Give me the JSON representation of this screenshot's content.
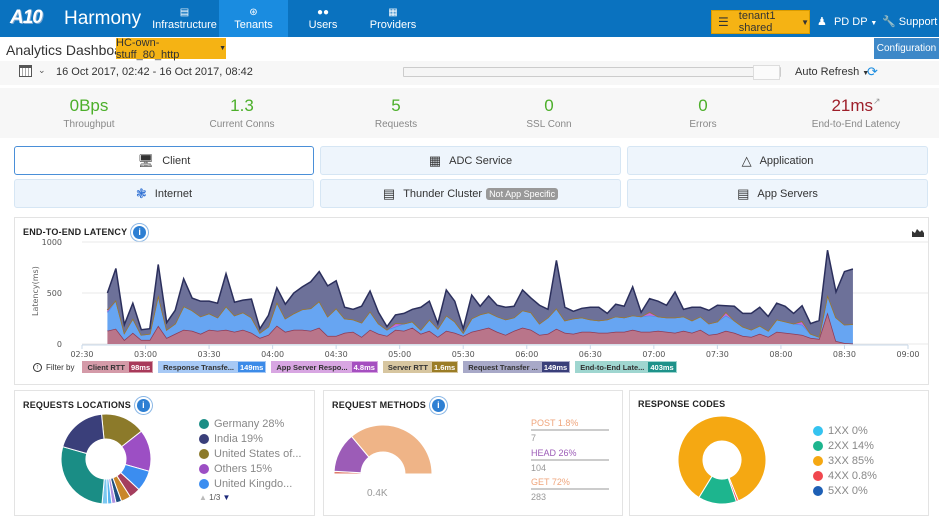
{
  "header": {
    "logo": "A10",
    "app_name": "Harmony",
    "nav": [
      {
        "label": "Infrastructure",
        "icon": "server-icon",
        "active": false
      },
      {
        "label": "Tenants",
        "icon": "tenants-icon",
        "active": true
      },
      {
        "label": "Users",
        "icon": "users-icon",
        "active": false
      },
      {
        "label": "Providers",
        "icon": "providers-icon",
        "active": false
      }
    ],
    "tenant_selector": "tenant1 shared",
    "user_menu": "PD DP",
    "support_menu": "Support"
  },
  "page": {
    "title": "Analytics Dashboard",
    "service_selector": "HC-own-stuff_80_http",
    "configuration_button": "Configuration"
  },
  "timebar": {
    "range": "16 Oct 2017, 02:42 - 16 Oct 2017, 08:42",
    "auto_refresh": "Auto Refresh"
  },
  "kpis": [
    {
      "value": "0Bps",
      "label": "Throughput",
      "status": "good"
    },
    {
      "value": "1.3",
      "label": "Current Conns",
      "status": "good"
    },
    {
      "value": "5",
      "label": "Requests",
      "status": "good"
    },
    {
      "value": "0",
      "label": "SSL Conn",
      "status": "good"
    },
    {
      "value": "0",
      "label": "Errors",
      "status": "good"
    },
    {
      "value": "21ms",
      "label": "End-to-End Latency",
      "status": "bad"
    }
  ],
  "tiles": [
    {
      "label": "Client",
      "icon": "client-monitor-icon",
      "selected": true
    },
    {
      "label": "ADC Service",
      "icon": "adc-service-icon",
      "selected": false
    },
    {
      "label": "Application",
      "icon": "application-icon",
      "selected": false
    },
    {
      "label": "Internet",
      "icon": "internet-icon",
      "selected": false
    },
    {
      "label": "Thunder Cluster",
      "icon": "cluster-icon",
      "badge": "Not App Specific",
      "selected": false
    },
    {
      "label": "App Servers",
      "icon": "app-servers-icon",
      "selected": false
    }
  ],
  "latency_panel": {
    "title": "END-TO-END LATENCY",
    "filter_label": "Filter by",
    "filters": [
      {
        "label": "Client RTT",
        "value": "98ms",
        "bg": "#d49aa8",
        "vbg": "#a8395a"
      },
      {
        "label": "Response Transfe...",
        "value": "149ms",
        "bg": "#a7c9f5",
        "vbg": "#3c8be8"
      },
      {
        "label": "App Server Respo...",
        "value": "4.8ms",
        "bg": "#d8a6e2",
        "vbg": "#a54fc0"
      },
      {
        "label": "Server RTT",
        "value": "1.6ms",
        "bg": "#d7c6a0",
        "vbg": "#9b7d26"
      },
      {
        "label": "Request Transfer ...",
        "value": "149ms",
        "bg": "#a8a9c8",
        "vbg": "#3a3f7a"
      },
      {
        "label": "End-to-End Late...",
        "value": "403ms",
        "bg": "#9fd6d0",
        "vbg": "#1e928a"
      }
    ]
  },
  "chart_data": [
    {
      "type": "area",
      "stacked": true,
      "title": "END-TO-END LATENCY",
      "xlabel": "",
      "ylabel": "Latency(ms)",
      "ylim": [
        0,
        1000
      ],
      "yticks": [
        "0",
        "500",
        "1000"
      ],
      "xlim": [
        "02:30",
        "09:00"
      ],
      "xticks": [
        "02:30",
        "03:00",
        "03:30",
        "04:00",
        "04:30",
        "05:00",
        "05:30",
        "06:00",
        "06:30",
        "07:00",
        "07:30",
        "08:00",
        "08:30",
        "09:00"
      ],
      "x_start_minutes": 162,
      "x_step_minutes": 4,
      "grid": true,
      "series": [
        {
          "name": "Client RTT",
          "color": "#b9758a",
          "line": "#8e3a55",
          "values": [
            130,
            150,
            40,
            110,
            40,
            40,
            180,
            60,
            100,
            140,
            130,
            100,
            140,
            130,
            140,
            120,
            140,
            110,
            60,
            90,
            180,
            120,
            140,
            140,
            130,
            160,
            80,
            80,
            110,
            120,
            70,
            140,
            100,
            80,
            140,
            130,
            160,
            100,
            130,
            70,
            130,
            110,
            80,
            120,
            140,
            160,
            120,
            90,
            130,
            160,
            140,
            90,
            100,
            150,
            110,
            100,
            120,
            120,
            110,
            110,
            120,
            120,
            140,
            120,
            120,
            130,
            120,
            110,
            130,
            110,
            140,
            90,
            100,
            130,
            110,
            80,
            70,
            100,
            70,
            120,
            110,
            100,
            90,
            60,
            50,
            310,
            30,
            10,
            5
          ]
        },
        {
          "name": "Response Transfer",
          "color": "#67a5f2",
          "line": "#4c8fe8",
          "values": [
            180,
            280,
            70,
            140,
            50,
            60,
            300,
            80,
            100,
            230,
            200,
            170,
            160,
            130,
            230,
            160,
            170,
            150,
            50,
            80,
            230,
            130,
            160,
            200,
            220,
            260,
            190,
            270,
            140,
            120,
            140,
            180,
            100,
            60,
            30,
            70,
            60,
            40,
            110,
            80,
            150,
            110,
            30,
            130,
            150,
            150,
            150,
            150,
            130,
            170,
            170,
            110,
            160,
            200,
            120,
            150,
            140,
            120,
            120,
            130,
            150,
            140,
            140,
            150,
            160,
            140,
            140,
            150,
            140,
            120,
            130,
            110,
            120,
            150,
            120,
            90,
            70,
            80,
            60,
            120,
            110,
            100,
            100,
            40,
            20,
            170,
            230,
            180,
            190
          ]
        },
        {
          "name": "App Server Response",
          "color": "#c76ed9",
          "line": "#a54fc0",
          "values": [
            20,
            0,
            0,
            0,
            0,
            0,
            0,
            0,
            0,
            0,
            0,
            0,
            0,
            0,
            0,
            0,
            0,
            0,
            0,
            0,
            0,
            0,
            0,
            0,
            0,
            0,
            0,
            0,
            0,
            0,
            0,
            0,
            0,
            0,
            30,
            0,
            0,
            0,
            0,
            0,
            0,
            0,
            0,
            0,
            0,
            0,
            0,
            0,
            0,
            0,
            0,
            0,
            0,
            0,
            0,
            0,
            0,
            0,
            0,
            0,
            0,
            0,
            0,
            0,
            30,
            0,
            0,
            0,
            0,
            0,
            0,
            0,
            0,
            30,
            0,
            0,
            0,
            0,
            0,
            0,
            0,
            0,
            30,
            0,
            0,
            0,
            0,
            0,
            0
          ]
        },
        {
          "name": "Server RTT",
          "color": "#b99a45",
          "line": "#9b7d26",
          "values": [
            5,
            0,
            0,
            0,
            0,
            0,
            0,
            0,
            0,
            0,
            0,
            0,
            0,
            0,
            0,
            0,
            0,
            0,
            0,
            0,
            0,
            0,
            0,
            0,
            0,
            0,
            0,
            0,
            0,
            0,
            0,
            0,
            0,
            0,
            5,
            0,
            0,
            0,
            0,
            0,
            0,
            0,
            0,
            0,
            0,
            0,
            0,
            0,
            0,
            0,
            0,
            0,
            0,
            0,
            0,
            0,
            0,
            0,
            0,
            0,
            0,
            0,
            0,
            0,
            5,
            0,
            0,
            0,
            0,
            0,
            0,
            0,
            0,
            5,
            0,
            0,
            0,
            0,
            0,
            0,
            0,
            0,
            5,
            0,
            0,
            0,
            0,
            0,
            0
          ]
        },
        {
          "name": "Request Transfer",
          "color": "#6d7199",
          "line": "#2b2f5c",
          "values": [
            165,
            310,
            80,
            150,
            50,
            50,
            300,
            70,
            130,
            270,
            120,
            150,
            120,
            140,
            320,
            130,
            120,
            180,
            40,
            110,
            140,
            140,
            200,
            220,
            260,
            290,
            300,
            270,
            110,
            100,
            160,
            200,
            110,
            30,
            80,
            100,
            120,
            220,
            180,
            50,
            250,
            200,
            40,
            230,
            80,
            160,
            110,
            120,
            110,
            200,
            140,
            180,
            80,
            470,
            130,
            70,
            90,
            120,
            130,
            60,
            120,
            110,
            280,
            40,
            130,
            150,
            120,
            250,
            70,
            130,
            90,
            130,
            160,
            60,
            140,
            130,
            160,
            180,
            140,
            160,
            150,
            100,
            150,
            100,
            160,
            440,
            250,
            520,
            540
          ]
        }
      ]
    },
    {
      "type": "pie",
      "title": "REQUESTS LOCATIONS",
      "donut": true,
      "slices": [
        {
          "label": "Germany",
          "value": 28,
          "color": "#1a8d85"
        },
        {
          "label": "India",
          "value": 19,
          "color": "#3a3f7a"
        },
        {
          "label": "United States of...",
          "value": 16,
          "color": "#8c7a2a"
        },
        {
          "label": "Others",
          "value": 15,
          "color": "#9c4fc4"
        },
        {
          "label": "United Kingdo...",
          "value": 7.5,
          "color": "#3b8df0"
        },
        {
          "label": "",
          "value": 4,
          "color": "#a43e5e"
        },
        {
          "label": "",
          "value": 3.5,
          "color": "#c9862a"
        },
        {
          "label": "",
          "value": 2,
          "color": "#1e4f80"
        },
        {
          "label": "",
          "value": 1.5,
          "color": "#b090e0"
        },
        {
          "label": "",
          "value": 1.5,
          "color": "#5ab6f0"
        },
        {
          "label": "",
          "value": 2,
          "color": "#7cc8f0"
        }
      ],
      "legend": [
        "Germany 28%",
        "India 19%",
        "United States of...",
        "Others 15%",
        "United Kingdo..."
      ],
      "legend_page": "1/3"
    },
    {
      "type": "pie",
      "title": "REQUEST METHODS",
      "donut": true,
      "half": true,
      "center_label": "0.4K",
      "slices": [
        {
          "label": "POST",
          "percent": "1.8%",
          "count": 7,
          "value": 1.8,
          "color": "#e07b6a"
        },
        {
          "label": "HEAD",
          "percent": "26%",
          "count": 104,
          "value": 26,
          "color": "#9c5cb7"
        },
        {
          "label": "GET",
          "percent": "72%",
          "count": 283,
          "value": 72,
          "color": "#efb487"
        }
      ]
    },
    {
      "type": "pie",
      "title": "RESPONSE CODES",
      "donut": true,
      "slices": [
        {
          "label": "1XX",
          "percent": "0%",
          "value": 0,
          "color": "#35c3f0"
        },
        {
          "label": "2XX",
          "percent": "14%",
          "value": 14,
          "color": "#1db58e"
        },
        {
          "label": "3XX",
          "percent": "85%",
          "value": 85,
          "color": "#f5a812"
        },
        {
          "label": "4XX",
          "percent": "0.8%",
          "value": 0.8,
          "color": "#f0474e"
        },
        {
          "label": "5XX",
          "percent": "0%",
          "value": 0,
          "color": "#1d5fb5"
        }
      ]
    }
  ]
}
